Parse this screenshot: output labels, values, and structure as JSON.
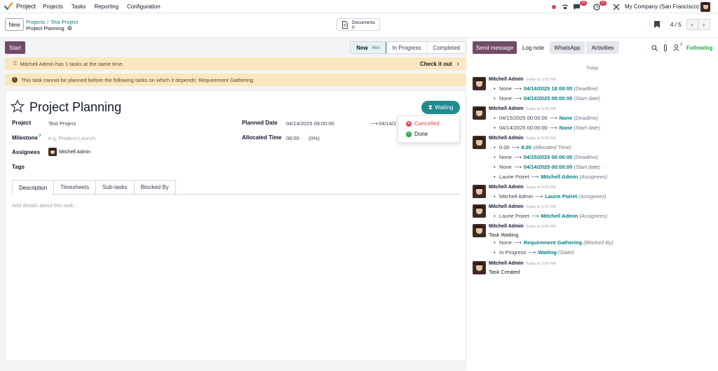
{
  "topbar": {
    "app_name": "Project",
    "menu": [
      "Projects",
      "Tasks",
      "Reporting",
      "Configuration"
    ],
    "badges": {
      "chat": "10",
      "activities": "12"
    },
    "company": "My Company (San Francisco)"
  },
  "control": {
    "new_label": "New",
    "breadcrumb": [
      "Projects",
      "Test Project"
    ],
    "record_title": "Project Planning",
    "documents_label": "Documents",
    "documents_count": "0",
    "pager": "4 / 5"
  },
  "statusbar": {
    "start_label": "Start",
    "stages": [
      {
        "label": "New",
        "duration": "46m",
        "active": true
      },
      {
        "label": "In Progress",
        "duration": "",
        "active": false
      },
      {
        "label": "Completed",
        "duration": "",
        "active": false
      }
    ]
  },
  "alerts": {
    "overlap": "Mitchell Admin has 1 tasks at the same time.",
    "check_label": "Check it out",
    "dependency": "This task cannot be planned before the following tasks on which it depends: Requirement Gathering"
  },
  "form": {
    "title": "Project Planning",
    "project_label": "Project",
    "project_value": "Test Project",
    "milestone_label": "Milestone",
    "milestone_help": "?",
    "milestone_placeholder": "e.g. Product Launch",
    "assignees_label": "Assignees",
    "assignee_value": "Mitchell Admin",
    "tags_label": "Tags",
    "planned_date_label": "Planned Date",
    "planned_start": "04/14/2025 09:00:00",
    "planned_end": "04/14/2",
    "allocated_label": "Allocated Time",
    "allocated_value": "08:00",
    "allocated_pct": "(0%)",
    "state_label": "Waiting",
    "state_options": [
      {
        "label": "Cancelled",
        "color": "#d44c59"
      },
      {
        "label": "Done",
        "color": "#28a745"
      }
    ],
    "tabs": [
      "Description",
      "Timesheets",
      "Sub-tasks",
      "Blocked By"
    ],
    "description_placeholder": "Add details about this task..."
  },
  "chatter": {
    "buttons": [
      "Send message",
      "Log note",
      "WhatsApp",
      "Activities"
    ],
    "followers_count": "2",
    "following_label": "Following",
    "today_label": "Today",
    "messages": [
      {
        "author": "Mitchell Admin",
        "time": "Today at 3:30 PM",
        "text": "",
        "changes": [
          {
            "old": "None",
            "new": "04/14/2025 18:00:00",
            "field": "(Deadline)"
          },
          {
            "old": "None",
            "new": "04/14/2025 09:00:00",
            "field": "(Start date)"
          }
        ]
      },
      {
        "author": "Mitchell Admin",
        "time": "Today at 3:30 PM",
        "text": "",
        "changes": [
          {
            "old": "04/15/2025 00:00:00",
            "new": "None",
            "field": "(Deadline)"
          },
          {
            "old": "04/14/2025 00:00:00",
            "new": "None",
            "field": "(Start date)"
          }
        ]
      },
      {
        "author": "Mitchell Admin",
        "time": "Today at 3:29 PM",
        "text": "",
        "changes": [
          {
            "old": "0.00",
            "new": "8.00",
            "field": "(Allocated Time)"
          },
          {
            "old": "None",
            "new": "04/15/2025 00:00:00",
            "field": "(Deadline)"
          },
          {
            "old": "None",
            "new": "04/14/2025 00:00:00",
            "field": "(Start date)"
          },
          {
            "old": "Laurie Poiret",
            "new": "Mitchell Admin",
            "field": "(Assignees)"
          }
        ]
      },
      {
        "author": "Mitchell Admin",
        "time": "Today at 3:26 PM",
        "text": "",
        "changes": [
          {
            "old": "Mitchell Admin",
            "new": "Laurie Poiret",
            "field": "(Assignees)"
          }
        ]
      },
      {
        "author": "Mitchell Admin",
        "time": "Today at 3:23 PM",
        "text": "",
        "changes": [
          {
            "old": "Laurie Poiret",
            "new": "Mitchell Admin",
            "field": "(Assignees)"
          }
        ]
      },
      {
        "author": "Mitchell Admin",
        "time": "Today at 3:06 PM",
        "text": "Task Waiting",
        "changes": [
          {
            "old": "None",
            "new": "Requirement Gathering",
            "field": "(Blocked By)"
          },
          {
            "old": "In Progress",
            "new": "Waiting",
            "field": "(State)"
          }
        ]
      },
      {
        "author": "Mitchell Admin",
        "time": "Today at 2:59 PM",
        "text": "Task Created",
        "changes": []
      }
    ]
  },
  "colors": {
    "brand": "#714b67",
    "accent": "#017e84",
    "waiting": "#1f8b8f",
    "warning_bg": "#fbe7bf"
  }
}
